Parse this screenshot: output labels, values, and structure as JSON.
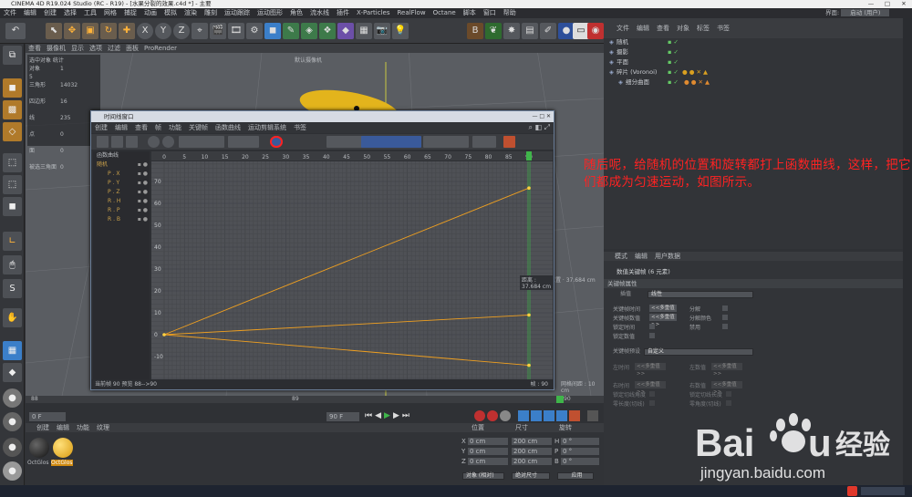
{
  "window": {
    "title": "CINEMA 4D R19.024 Studio (RC - R19) - [水果分裂的效果.c4d *] - 主要",
    "min": "—",
    "max": "□",
    "close": "✕"
  },
  "menubar": [
    "文件",
    "编辑",
    "创建",
    "选择",
    "工具",
    "网格",
    "捕捉",
    "动画",
    "模拟",
    "渲染",
    "雕刻",
    "运动跟踪",
    "运动图形",
    "角色",
    "流水线",
    "插件",
    "X-Particles",
    "RealFlow",
    "Octane",
    "脚本",
    "窗口",
    "帮助"
  ],
  "layout": {
    "label": "界面:",
    "value": "启动 (用户)"
  },
  "toolbar": {
    "undo_icon": "↶",
    "xyz": [
      "X",
      "Y",
      "Z"
    ]
  },
  "viewport": {
    "menu": [
      "查看",
      "摄像机",
      "显示",
      "选项",
      "过滤",
      "面板",
      "ProRender"
    ],
    "camera_label": "默认摄像机",
    "info": {
      "title": "选中对象 统计",
      "rows": [
        [
          "对象",
          "1",
          "5"
        ],
        [
          "三角形",
          "14032",
          ""
        ],
        [
          "四边形",
          "16",
          ""
        ],
        [
          "线",
          "235",
          ""
        ],
        [
          "点",
          "0",
          ""
        ],
        [
          "面",
          "0",
          ""
        ],
        [
          "被选三角面",
          "0",
          ""
        ]
      ]
    },
    "pos_label": "位置 · 37.684 cm",
    "frame_label": "帧:90",
    "grid_label": "网格间距 : 10 cm"
  },
  "timeline_window": {
    "title": "时间线窗口",
    "menu": [
      "创建",
      "编辑",
      "查看",
      "帧",
      "功能",
      "关键帧",
      "函数曲线",
      "运动剪辑系统",
      "书签"
    ],
    "tree_header": "函数曲线",
    "tracks": [
      "随机",
      "P . X",
      "P . Y",
      "P . Z",
      "R . H",
      "R . P",
      "R . B"
    ],
    "ruler": [
      "0",
      "5",
      "10",
      "15",
      "20",
      "25",
      "30",
      "35",
      "40",
      "45",
      "50",
      "55",
      "60",
      "65",
      "70",
      "75",
      "80",
      "85",
      "90"
    ],
    "yaxis": [
      "70",
      "60",
      "50",
      "40",
      "30",
      "20",
      "10",
      "0",
      "-10"
    ],
    "footer": "当前帧 90   预览 88-->90",
    "distance": "距离 : 37.684 cm",
    "frame": "帧 : 90"
  },
  "object_manager": {
    "menu": [
      "文件",
      "编辑",
      "查看",
      "对象",
      "标签",
      "书签"
    ],
    "objects": [
      {
        "name": "随机",
        "indent": 0
      },
      {
        "name": "摄影",
        "indent": 0
      },
      {
        "name": "平面",
        "indent": 0
      },
      {
        "name": "碎片 (Voronoi)",
        "indent": 0
      },
      {
        "name": "细分曲面",
        "indent": 1
      }
    ]
  },
  "attribute_manager": {
    "menu": [
      "模式",
      "编辑",
      "用户数据"
    ],
    "title": "数值关键帧 (6 元素)",
    "section": "关键帧属性",
    "interp_label": "插值",
    "interp_value": "线性",
    "fields": [
      {
        "label": "关键帧时间",
        "value": "<<多重值>>"
      },
      {
        "label": "关键帧数值",
        "value": "<<多重值>>"
      },
      {
        "label": "锁定时间",
        "value": ""
      },
      {
        "label": "锁定数值",
        "value": ""
      }
    ],
    "right_fields": [
      "分解",
      "分解颜色",
      "禁用"
    ],
    "preset_label": "关键帧预设",
    "preset_value": "自定义",
    "tangent_fields": [
      "左时间",
      "左数值",
      "右时间",
      "右数值"
    ],
    "tangent_value": "<<多重值>>",
    "right_tangent": [
      "锁定切线",
      "锁定切线数值",
      "锁定切线时间",
      "保持切线"
    ],
    "bottom_fields": [
      "锁定切线角度",
      "锁定切线长度",
      "零长度(切线)",
      "零角度(切线)"
    ]
  },
  "timeline": {
    "ruler": [
      "88",
      "89",
      "90"
    ],
    "current": "0 F",
    "end": "90 F",
    "frame_marker": "90"
  },
  "materials": {
    "menu": [
      "创建",
      "编辑",
      "功能",
      "纹理"
    ],
    "items": [
      "OctGlos",
      "OctGlos"
    ]
  },
  "coords": {
    "headers": [
      "位置",
      "尺寸",
      "旋转"
    ],
    "rows": [
      [
        "X",
        "0 cm",
        "200 cm",
        "H",
        "0 °"
      ],
      [
        "Y",
        "0 cm",
        "200 cm",
        "P",
        "0 °"
      ],
      [
        "Z",
        "0 cm",
        "200 cm",
        "B",
        "0 °"
      ]
    ],
    "mode1": "对象 (相对)",
    "mode2": "绝对尺寸",
    "apply": "应用"
  },
  "annotation": "随后呢，给随机的位置和旋转都打上函数曲线，这样，把它们都成为匀速运动，如图所示。",
  "watermark": {
    "brand": "Baidu",
    "cn": "经验",
    "url": "jingyan.baidu.com"
  },
  "colors": {
    "accent": "#ff8c1a",
    "annotation": "#ff2222",
    "curve": "#f0a020",
    "playhead": "#3fb54a"
  }
}
